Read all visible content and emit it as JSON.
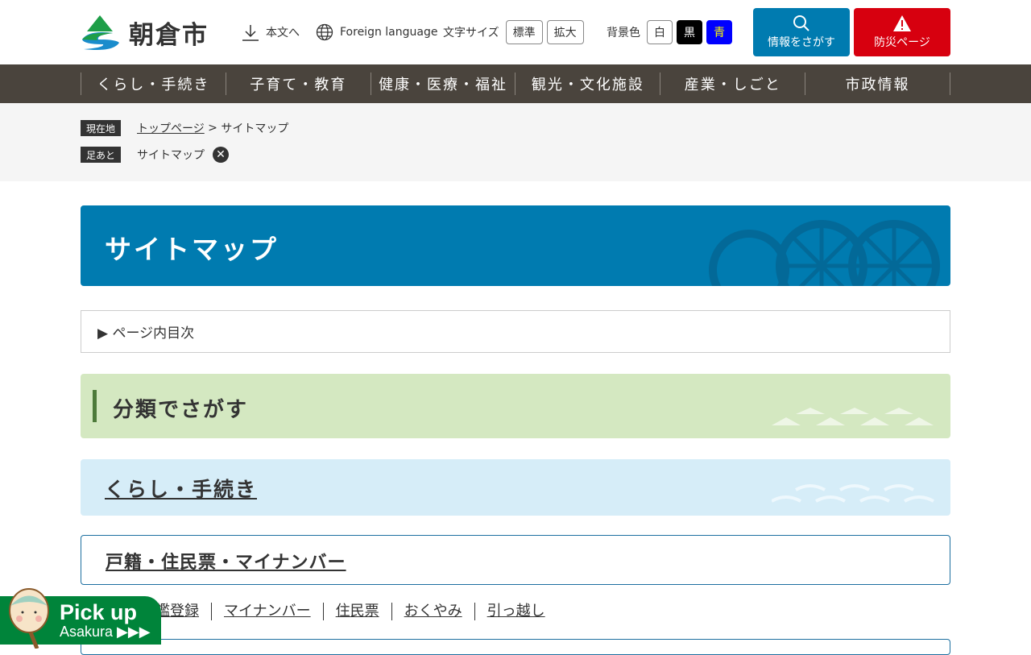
{
  "header": {
    "site_name": "朝倉市",
    "skip_label": "本文へ",
    "foreign_label": "Foreign language",
    "font_size_label": "文字サイズ",
    "font_standard": "標準",
    "font_large": "拡大",
    "bg_label": "背景色",
    "bg_white": "白",
    "bg_black": "黒",
    "bg_blue": "青",
    "search_label": "情報をさがす",
    "disaster_label": "防災ページ"
  },
  "colors": {
    "nav": "#4a443d",
    "brand_blue": "#007bb0",
    "disaster_red": "#d7000f",
    "pickup_green": "#00843a"
  },
  "nav": [
    "くらし・手続き",
    "子育て・教育",
    "健康・医療・福祉",
    "観光・文化施設",
    "産業・しごと",
    "市政情報"
  ],
  "breadcrumb": {
    "current_tag": "現在地",
    "home": "トップページ",
    "sep": " > ",
    "current": "サイトマップ",
    "history_tag": "足あと",
    "history_item": "サイトマップ"
  },
  "page_title": "サイトマップ",
  "toc_label": "▶ ページ内目次",
  "category_heading": "分類でさがす",
  "section": "くらし・手続き",
  "subsection": "戸籍・住民票・マイナンバー",
  "links": [
    "印鑑登録",
    "マイナンバー",
    "住民票",
    "おくやみ",
    "引っ越し"
  ],
  "pickup": {
    "line1": "Pick up",
    "line2": "Asakura ▶▶▶"
  }
}
